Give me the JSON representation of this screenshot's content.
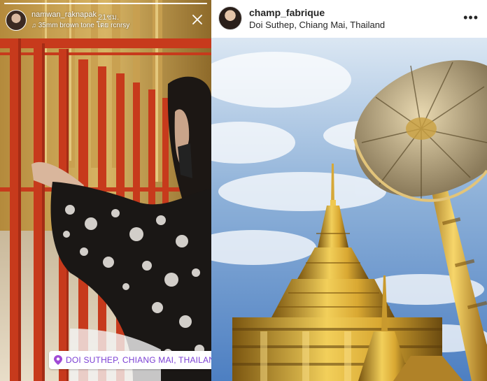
{
  "story": {
    "username": "namwan_raknapak",
    "time_ago": "21ชม.",
    "music": "35mm brown tone โดย rcnrsy",
    "music_icon": "music-note-icon",
    "close_icon": "close-icon",
    "progress": 1.0,
    "location_sticker": "DOI SUTHEP, CHIANG MAI, THAILAND",
    "location_icon": "location-pin-icon"
  },
  "post": {
    "username": "champ_fabrique",
    "location": "Doi Suthep, Chiang Mai, Thailand",
    "more_icon": "more-options-icon",
    "more_glyph": "•••"
  }
}
